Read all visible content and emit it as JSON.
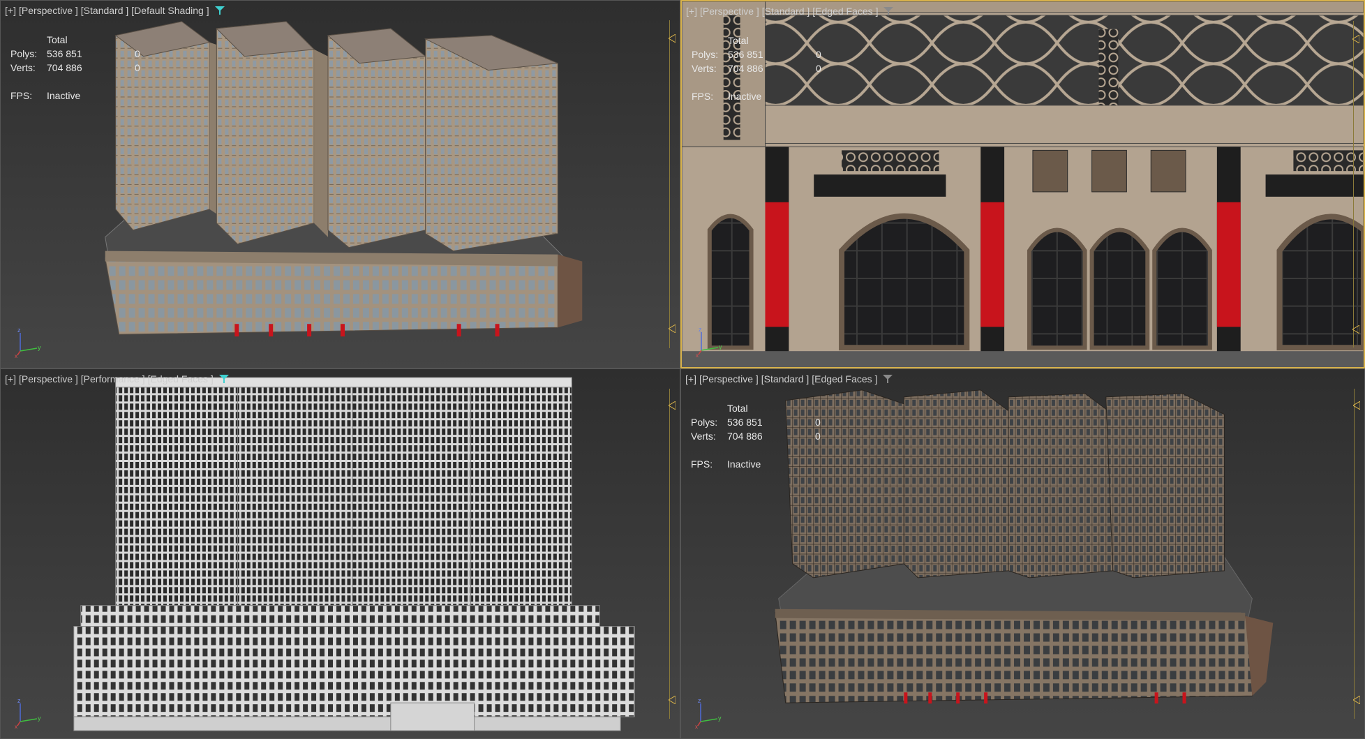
{
  "viewports": [
    {
      "label": {
        "plus": "[+]",
        "view": "[Perspective ]",
        "mode": "[Standard ]",
        "shading": "[Default Shading ]"
      },
      "filter_icon": "filter-funnel-icon",
      "filter_color": "#3fd0d0",
      "stats": {
        "header": "Total",
        "polys_label": "Polys:",
        "polys_total": "536 851",
        "polys_sel": "0",
        "verts_label": "Verts:",
        "verts_total": "704 886",
        "verts_sel": "0",
        "fps_label": "FPS:",
        "fps_value": "Inactive"
      }
    },
    {
      "label": {
        "plus": "[+]",
        "view": "[Perspective ]",
        "mode": "[Standard ]",
        "shading": "[Edged Faces ]"
      },
      "filter_icon": "filter-funnel-icon",
      "filter_color": "#8a8a8a",
      "stats": {
        "header": "Total",
        "polys_label": "Polys:",
        "polys_total": "536 851",
        "polys_sel": "0",
        "verts_label": "Verts:",
        "verts_total": "704 886",
        "verts_sel": "0",
        "fps_label": "FPS:",
        "fps_value": "Inactive"
      }
    },
    {
      "label": {
        "plus": "[+]",
        "view": "[Perspective ]",
        "mode": "[Performance ]",
        "shading": "[Edged Faces ]"
      },
      "filter_icon": "filter-funnel-icon",
      "filter_color": "#3fd0d0"
    },
    {
      "label": {
        "plus": "[+]",
        "view": "[Perspective ]",
        "mode": "[Standard ]",
        "shading": "[Edged Faces ]"
      },
      "filter_icon": "filter-funnel-icon",
      "filter_color": "#8a8a8a",
      "stats": {
        "header": "Total",
        "polys_label": "Polys:",
        "polys_total": "536 851",
        "polys_sel": "0",
        "verts_label": "Verts:",
        "verts_total": "704 886",
        "verts_sel": "0",
        "fps_label": "FPS:",
        "fps_value": "Inactive"
      }
    }
  ],
  "colors": {
    "accent_border": "#d8b24a",
    "facade": "#b0a08c",
    "facade_dark": "#8d7e6c",
    "accent_red": "#c8141c",
    "wire": "#c8c8c8"
  }
}
